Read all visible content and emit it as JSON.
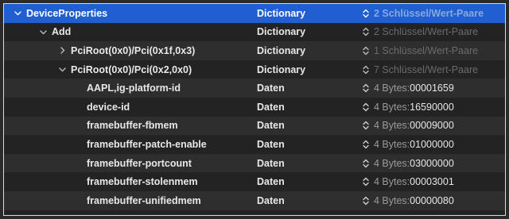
{
  "rows": [
    {
      "key": "DeviceProperties",
      "chevron": "down",
      "indent": 0,
      "type": "Dictionary",
      "value": "2 Schlüssel/Wert-Paare",
      "dim": true,
      "selected": true
    },
    {
      "key": "Add",
      "chevron": "down",
      "indent": 1,
      "type": "Dictionary",
      "value": "2 Schlüssel/Wert-Paare",
      "dim": true
    },
    {
      "key": "PciRoot(0x0)/Pci(0x1f,0x3)",
      "chevron": "right",
      "indent": 2,
      "type": "Dictionary",
      "value": "1 Schlüssel/Wert-Paare",
      "dim": true
    },
    {
      "key": "PciRoot(0x0)/Pci(0x2,0x0)",
      "chevron": "down",
      "indent": 2,
      "type": "Dictionary",
      "value": "7 Schlüssel/Wert-Paare",
      "dim": true
    },
    {
      "key": "AAPL,ig-platform-id",
      "chevron": "none",
      "indent": 3,
      "type": "Daten",
      "prefix": "4 Bytes: ",
      "value": "00001659",
      "dim": false
    },
    {
      "key": "device-id",
      "chevron": "none",
      "indent": 3,
      "type": "Daten",
      "prefix": "4 Bytes: ",
      "value": "16590000",
      "dim": false
    },
    {
      "key": "framebuffer-fbmem",
      "chevron": "none",
      "indent": 3,
      "type": "Daten",
      "prefix": "4 Bytes: ",
      "value": "00009000",
      "dim": false
    },
    {
      "key": "framebuffer-patch-enable",
      "chevron": "none",
      "indent": 3,
      "type": "Daten",
      "prefix": "4 Bytes: ",
      "value": "01000000",
      "dim": false
    },
    {
      "key": "framebuffer-portcount",
      "chevron": "none",
      "indent": 3,
      "type": "Daten",
      "prefix": "4 Bytes: ",
      "value": "03000000",
      "dim": false
    },
    {
      "key": "framebuffer-stolenmem",
      "chevron": "none",
      "indent": 3,
      "type": "Daten",
      "prefix": "4 Bytes: ",
      "value": "00003001",
      "dim": false
    },
    {
      "key": "framebuffer-unifiedmem",
      "chevron": "none",
      "indent": 3,
      "type": "Daten",
      "prefix": "4 Bytes: ",
      "value": "00000080",
      "dim": false
    }
  ],
  "colors": {
    "selection": "#1f5fd0",
    "dim_value": "#6b6b6b"
  },
  "icons": {
    "expanded": "chevron-down-icon",
    "collapsed": "chevron-right-icon",
    "stepper": "stepper-icon"
  }
}
